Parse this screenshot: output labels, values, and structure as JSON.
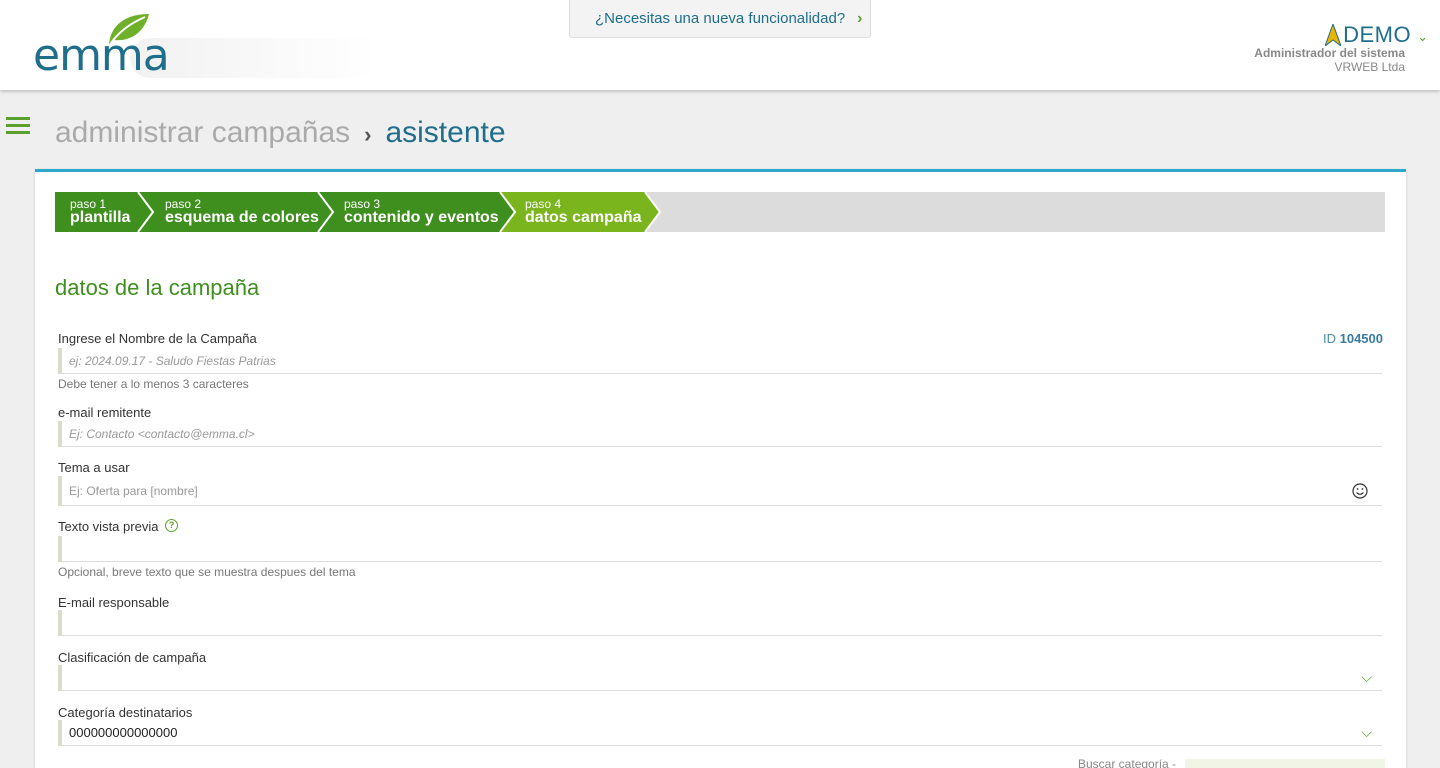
{
  "header": {
    "logo_text": "emma",
    "feature_request": "¿Necesitas una nueva funcionalidad?",
    "user": {
      "name": "DEMO",
      "role": "Administrador del sistema",
      "company": "VRWEB Ltda"
    }
  },
  "breadcrumb": {
    "parent": "administrar campañas",
    "separator": "›",
    "current": "asistente"
  },
  "steps": [
    {
      "num": "paso 1",
      "label": "plantilla",
      "state": "done"
    },
    {
      "num": "paso 2",
      "label": "esquema de colores",
      "state": "done"
    },
    {
      "num": "paso 3",
      "label": "contenido y eventos",
      "state": "done"
    },
    {
      "num": "paso 4",
      "label": "datos campaña",
      "state": "active"
    }
  ],
  "form": {
    "section_title": "datos de la campaña",
    "campaign_id_label": "ID",
    "campaign_id_value": "104500",
    "name": {
      "label": "Ingrese el Nombre de la Campaña",
      "placeholder": "ej: 2024.09.17 - Saludo Fiestas Patrias",
      "help": "Debe tener a lo menos 3 caracteres"
    },
    "sender": {
      "label": "e-mail remitente",
      "placeholder": "Ej: Contacto <contacto@emma.cl>"
    },
    "subject": {
      "label": "Tema a usar",
      "placeholder": "Ej: Oferta para [nombre]"
    },
    "preview": {
      "label": "Texto vista previa",
      "value": "",
      "help": "Opcional, breve texto que se muestra despues del tema"
    },
    "responsible": {
      "label": "E-mail responsable",
      "value": ""
    },
    "classification": {
      "label": "Clasificación de campaña",
      "value": ""
    },
    "category": {
      "label": "Categoría destinatarios",
      "value": "000000000000000"
    },
    "search_category_label": "Buscar categoría -"
  },
  "colors": {
    "brand_blue": "#1f6e8c",
    "brand_green": "#5aa02c",
    "step_done": "#3f8f1f",
    "step_active": "#7ab51d",
    "card_border": "#2da8c8"
  }
}
